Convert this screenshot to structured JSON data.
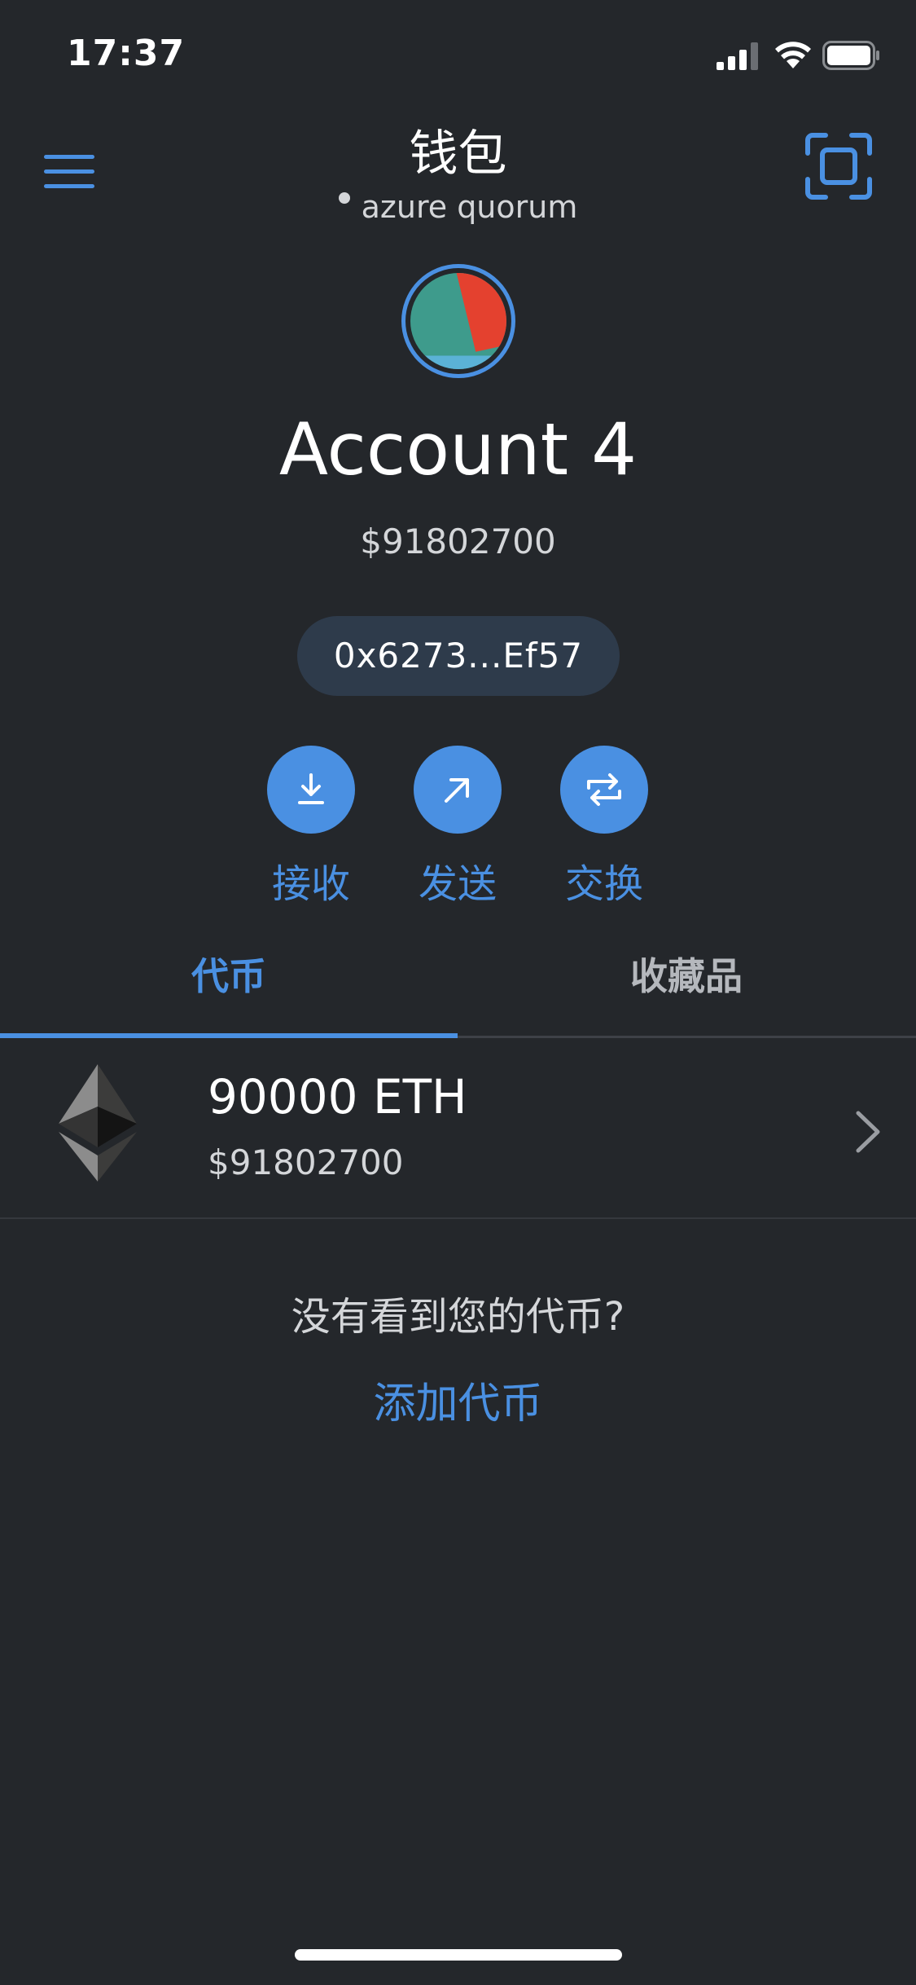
{
  "status_bar": {
    "time": "17:37"
  },
  "header": {
    "title": "钱包",
    "network": "azure quorum"
  },
  "account": {
    "name": "Account 4",
    "balance": "$91802700",
    "address": "0x6273...Ef57",
    "avatar_colors": [
      "#3e9b8c",
      "#e4412f",
      "#5bb2d6"
    ]
  },
  "actions": {
    "receive": "接收",
    "send": "发送",
    "swap": "交换"
  },
  "tabs": {
    "tokens": "代币",
    "collectibles": "收藏品",
    "active": "tokens"
  },
  "tokens": [
    {
      "amount": "90000 ETH",
      "fiat": "$91802700",
      "icon": "ethereum-icon"
    }
  ],
  "empty_state": {
    "message": "没有看到您的代币?",
    "add_link": "添加代币"
  },
  "colors": {
    "background": "#24272b",
    "accent": "#4a90e2",
    "address_pill": "#2e3b4b"
  }
}
